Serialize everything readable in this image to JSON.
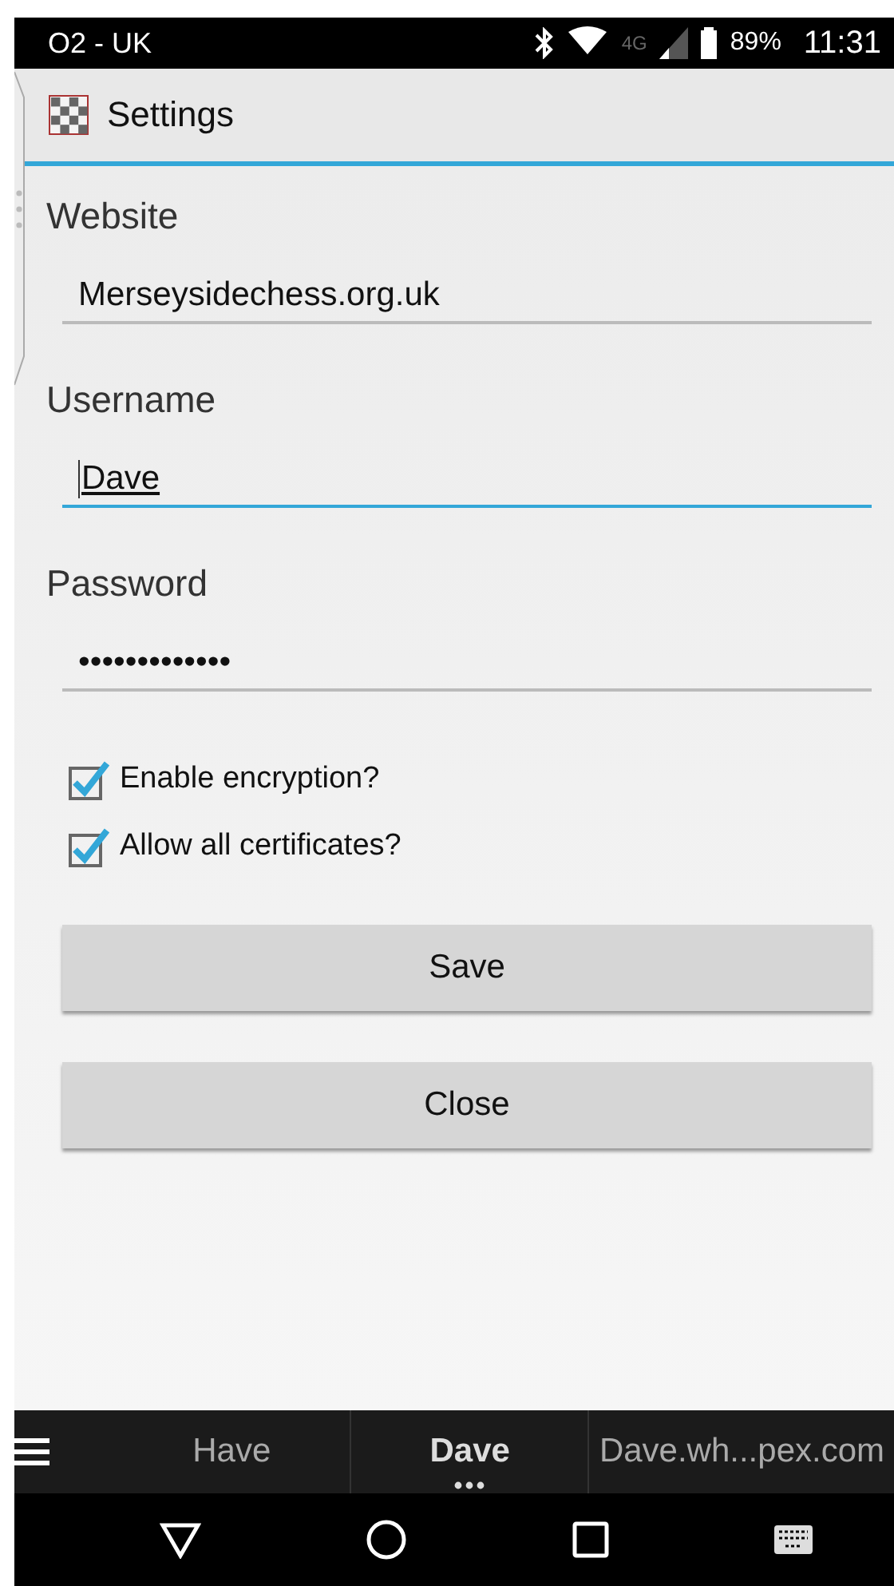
{
  "status_bar": {
    "carrier": "O2 - UK",
    "network": "4G",
    "battery": "89%",
    "time": "11:31"
  },
  "app_bar": {
    "title": "Settings"
  },
  "fields": [
    {
      "label": "Website",
      "value": "Merseysidechess.org.uk",
      "focused": false
    },
    {
      "label": "Username",
      "value": "Dave",
      "focused": true
    },
    {
      "label": "Password",
      "value": "•••••••••••••",
      "focused": false
    }
  ],
  "checkboxes": [
    {
      "label": "Enable encryption?",
      "checked": true
    },
    {
      "label": "Allow all certificates?",
      "checked": true
    }
  ],
  "buttons": [
    "Save",
    "Close"
  ],
  "bottom_tabs": [
    {
      "label": "Have",
      "selected": false
    },
    {
      "label": "Dave",
      "selected": true
    },
    {
      "label": "Dave.wh...pex.com",
      "selected": false
    }
  ]
}
